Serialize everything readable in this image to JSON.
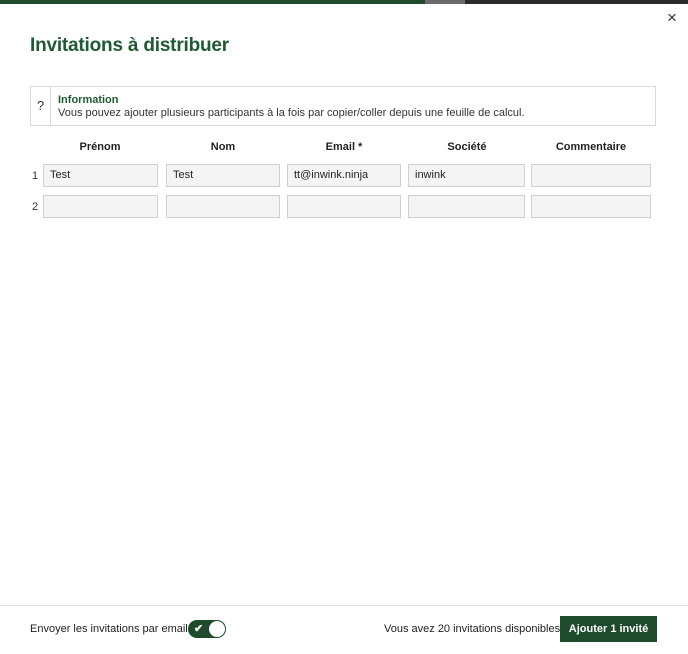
{
  "dialog": {
    "title": "Invitations à distribuer",
    "close_glyph": "×"
  },
  "info": {
    "icon_glyph": "?",
    "title": "Information",
    "text": "Vous pouvez ajouter plusieurs participants à la fois par copier/coller depuis une feuille de calcul."
  },
  "table": {
    "headers": [
      "Prénom",
      "Nom",
      "Email *",
      "Société",
      "Commentaire"
    ],
    "rows": [
      {
        "number": "1",
        "cells": [
          "Test",
          "Test",
          "tt@inwink.ninja",
          "inwink",
          ""
        ]
      },
      {
        "number": "2",
        "cells": [
          "",
          "",
          "",
          "",
          ""
        ]
      }
    ]
  },
  "footer": {
    "send_label": "Envoyer les invitations par email",
    "send_enabled": true,
    "available_text": "Vous avez 20 invitations disponibles",
    "add_button": "Ajouter 1 invité"
  },
  "colors": {
    "accent": "#1e5a32",
    "button": "#1e4b2b"
  }
}
